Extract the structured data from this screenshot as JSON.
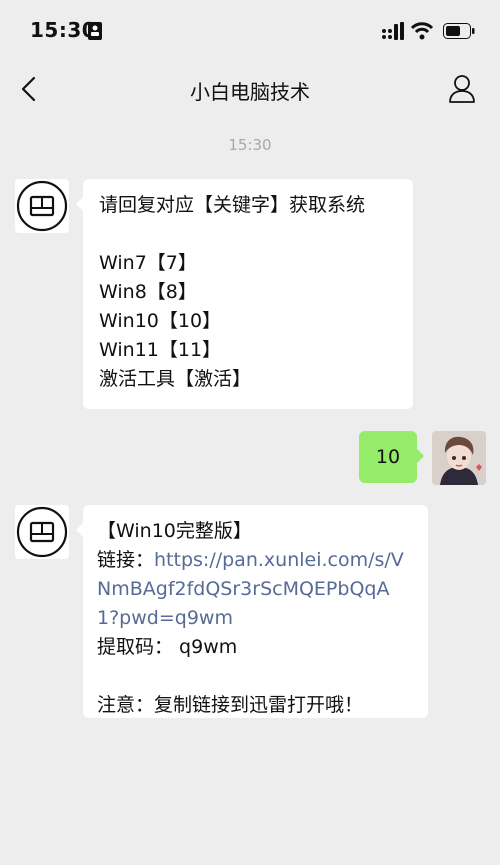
{
  "status_bar": {
    "time": "15:30",
    "icons": [
      "id-card-icon",
      "signal-icon",
      "wifi-icon",
      "battery-icon"
    ]
  },
  "header": {
    "title": "小白电脑技术",
    "back_icon": "chevron-left-icon",
    "profile_icon": "person-icon"
  },
  "chat": {
    "timestamp": "15:30",
    "messages": [
      {
        "from": "other",
        "lines": [
          "请回复对应【关键字】获取系统",
          "",
          "Win7【7】",
          "Win8【8】",
          "Win10【10】",
          "Win11【11】",
          "激活工具【激活】"
        ]
      },
      {
        "from": "me",
        "text": "10"
      },
      {
        "from": "other",
        "title": "【Win10完整版】",
        "link_label": "链接：",
        "link_lines": [
          "https://pan.xunlei.com/s/V",
          "NmBAgf2fdQSr3rScMQEPbQqA",
          "1?pwd=q9wm"
        ],
        "code_line": "提取码： q9wm",
        "note": "注意：复制链接到迅雷打开哦！"
      }
    ]
  },
  "colors": {
    "background": "#ededed",
    "sent_bubble": "#95ec69",
    "link": "#576b95",
    "timestamp": "#a9a9a9"
  }
}
